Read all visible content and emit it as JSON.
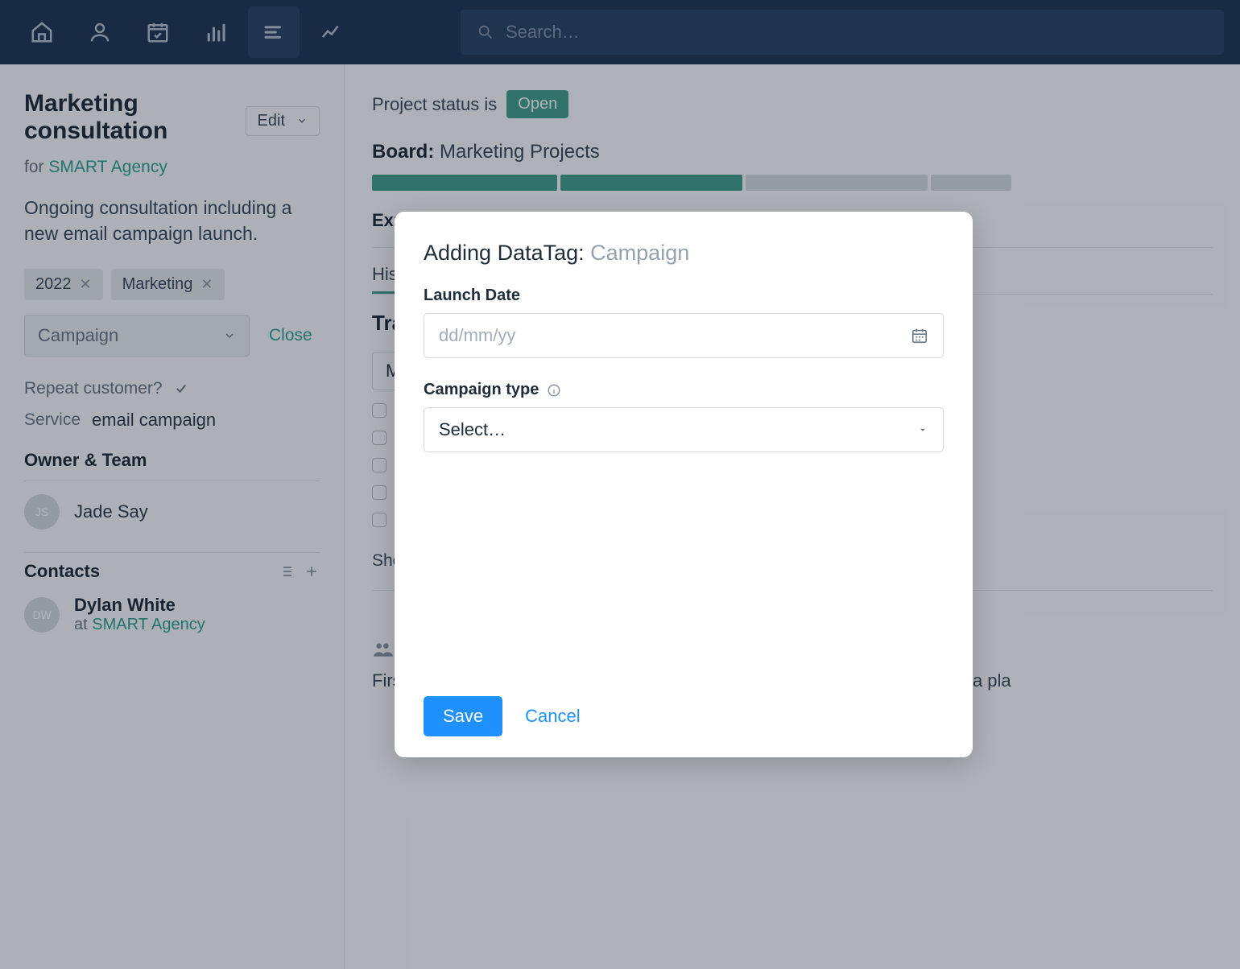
{
  "topbar": {
    "search_placeholder": "Search…"
  },
  "sidebar": {
    "title": "Marketing consultation",
    "edit_label": "Edit",
    "for_label": "for",
    "agency": "SMART Agency",
    "description": "Ongoing consultation including a new email campaign launch.",
    "tags": [
      "2022",
      "Marketing"
    ],
    "tag_select": "Campaign",
    "close_label": "Close",
    "repeat_label": "Repeat customer?",
    "service_label": "Service",
    "service_value": "email campaign",
    "owner_heading": "Owner & Team",
    "owner_initials": "JS",
    "owner_name": "Jade Say",
    "contacts_heading": "Contacts",
    "contact_initials": "DW",
    "contact_name": "Dylan White",
    "contact_at": "at",
    "contact_agency": "SMART Agency"
  },
  "main": {
    "status_label": "Project status is",
    "status_value": "Open",
    "board_label": "Board:",
    "board_name": "Marketing Projects",
    "expected": "Exp",
    "tab_history": "His",
    "tracks_heading": "Tra",
    "task_prefix": "M",
    "show_more": "Sho",
    "bottom_text": "First meeting to discuss potential consultancy went well, now need to gather a pla"
  },
  "modal": {
    "title_prefix": "Adding DataTag:",
    "tag_name": "Campaign",
    "field1_label": "Launch Date",
    "field1_placeholder": "dd/mm/yy",
    "field2_label": "Campaign type",
    "field2_placeholder": "Select…",
    "save_label": "Save",
    "cancel_label": "Cancel"
  }
}
